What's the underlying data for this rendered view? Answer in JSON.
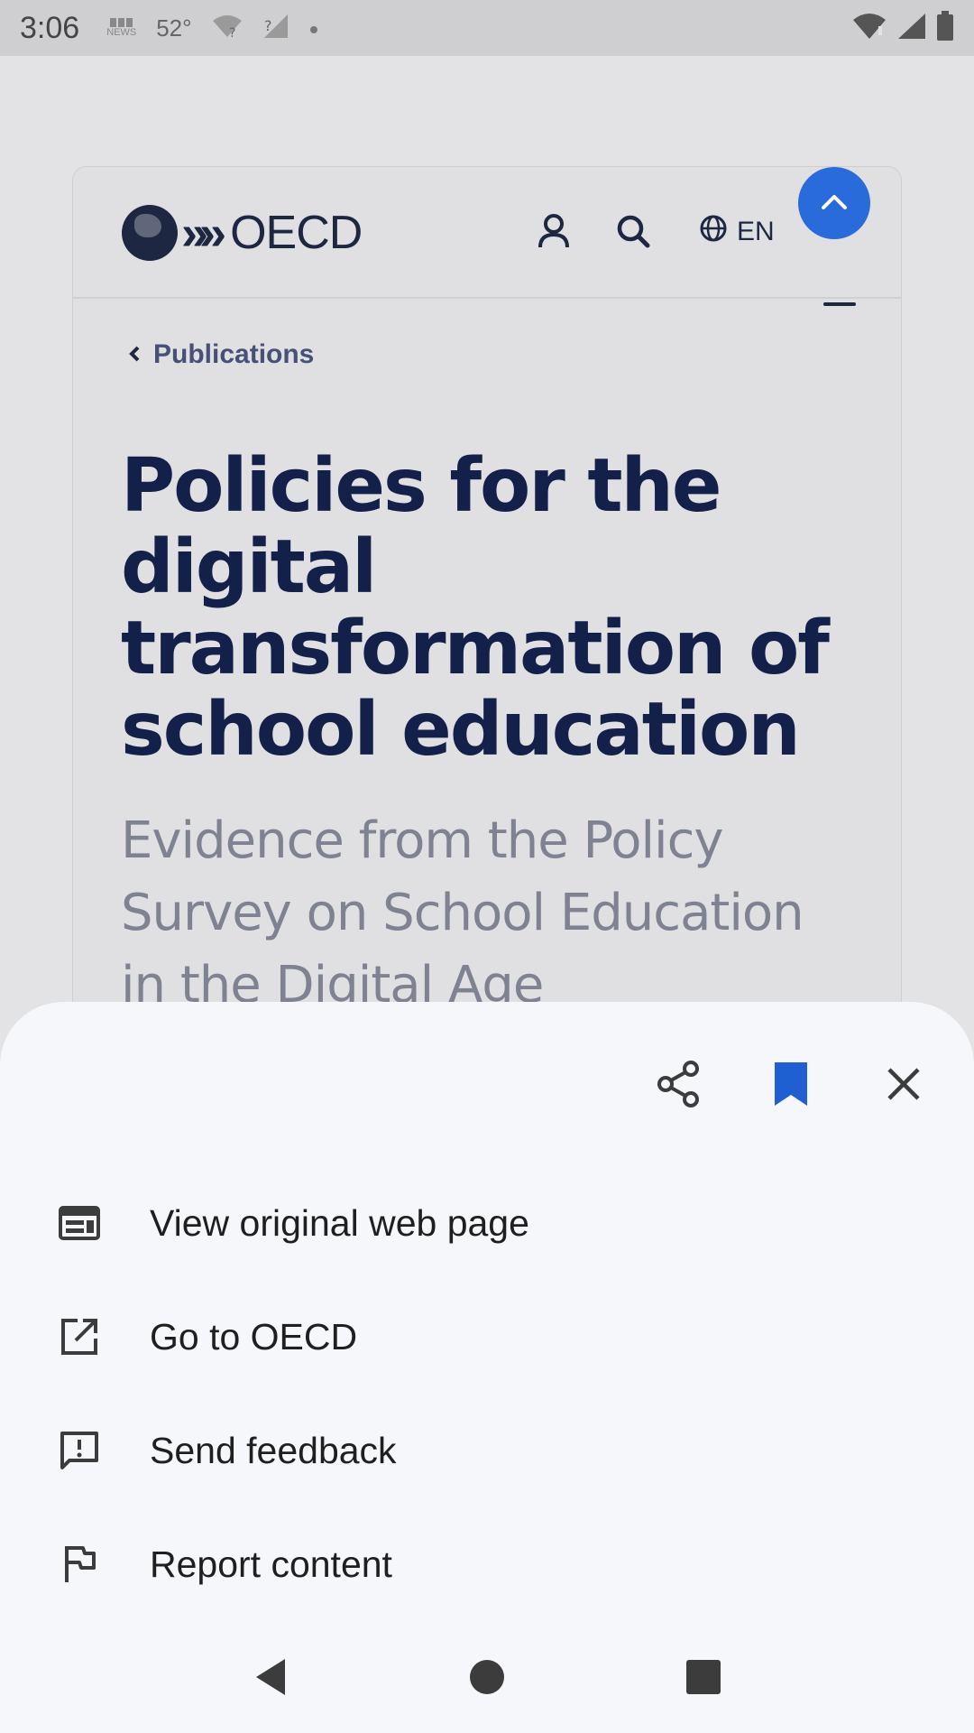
{
  "status_bar": {
    "time": "3:06",
    "news_label": "NEWS",
    "temperature": "52°",
    "icons": [
      "bbc-news-icon",
      "wifi-question-icon",
      "signal-question-icon",
      "dot-icon",
      "wifi-icon",
      "signal-icon",
      "battery-icon"
    ]
  },
  "web_page": {
    "logo_text": "OECD",
    "language": "EN",
    "breadcrumb": "Publications",
    "title": "Policies for the digital transformation of school education",
    "subtitle": "Evidence from the Policy Survey on School Education in the Digital Age",
    "icons": [
      "account-icon",
      "search-icon",
      "globe-icon",
      "chevron-up-icon"
    ]
  },
  "sheet": {
    "actions": [
      "share-icon",
      "bookmark-icon",
      "close-icon"
    ],
    "menu": [
      {
        "label": "View original web page",
        "icon": "web-page-icon"
      },
      {
        "label": "Go to OECD",
        "icon": "open-external-icon"
      },
      {
        "label": "Send feedback",
        "icon": "feedback-icon"
      },
      {
        "label": "Report content",
        "icon": "flag-icon"
      }
    ]
  },
  "colors": {
    "accent_blue": "#2a6bdc",
    "title_navy": "#13204a",
    "sheet_bg": "#f6f7fb"
  }
}
